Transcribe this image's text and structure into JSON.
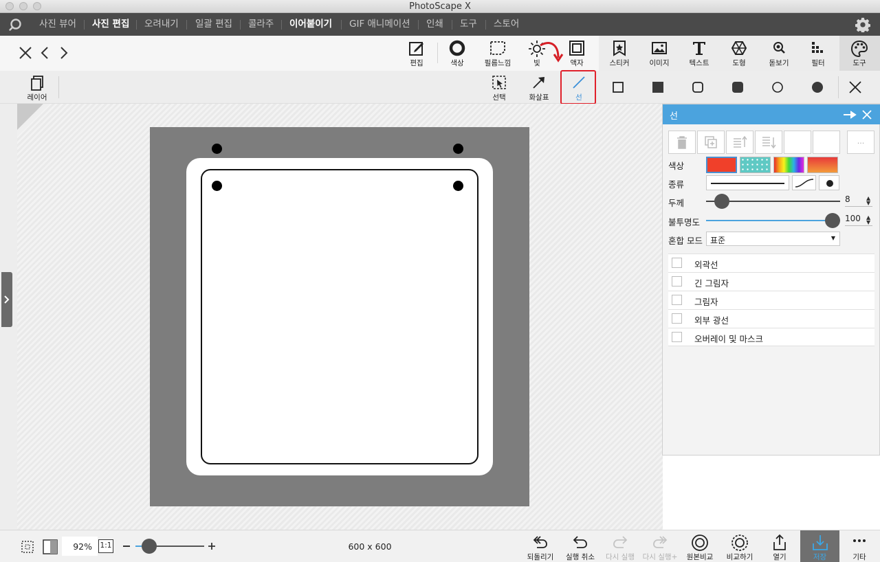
{
  "window": {
    "title": "PhotoScape X"
  },
  "menu": {
    "items": [
      {
        "label": "사진 뷰어"
      },
      {
        "label": "사진 편집"
      },
      {
        "label": "오려내기"
      },
      {
        "label": "일괄 편집"
      },
      {
        "label": "콜라주"
      },
      {
        "label": "이어붙이기"
      },
      {
        "label": "GIF 애니메이션"
      },
      {
        "label": "인쇄"
      },
      {
        "label": "도구"
      },
      {
        "label": "스토어"
      }
    ]
  },
  "toolbar": {
    "tools": [
      {
        "label": "편집",
        "icon": "edit-icon"
      },
      {
        "label": "색상",
        "icon": "color-ring-icon"
      },
      {
        "label": "필름느낌",
        "icon": "film-icon"
      },
      {
        "label": "빛",
        "icon": "sun-icon"
      },
      {
        "label": "액자",
        "icon": "frame-icon"
      },
      {
        "label": "스티커",
        "icon": "sticker-icon"
      },
      {
        "label": "이미지",
        "icon": "image-icon"
      },
      {
        "label": "텍스트",
        "icon": "text-icon"
      },
      {
        "label": "도형",
        "icon": "shape-icon"
      },
      {
        "label": "돋보기",
        "icon": "magnifier-icon"
      },
      {
        "label": "필터",
        "icon": "filter-icon"
      },
      {
        "label": "도구",
        "icon": "palette-icon"
      }
    ]
  },
  "toolbar2": {
    "layer_label": "레이어",
    "select_label": "선택",
    "arrow_label": "화살표",
    "line_label": "선"
  },
  "canvas": {
    "dimensions": "600 x 600"
  },
  "panel": {
    "title": "선",
    "more_label": "...",
    "color_label": "색상",
    "type_label": "종류",
    "thickness_label": "두께",
    "thickness_value": "8",
    "opacity_label": "불투명도",
    "opacity_value": "100",
    "blend_label": "혼합 모드",
    "blend_value": "표준",
    "colors": {
      "solid": "#f0402a",
      "pattern": "#5fc9c4",
      "gradient_end": "#e83a3a"
    },
    "effects": [
      {
        "label": "외곽선",
        "checked": false
      },
      {
        "label": "긴 그림자",
        "checked": false
      },
      {
        "label": "그림자",
        "checked": false
      },
      {
        "label": "외부 광선",
        "checked": false
      },
      {
        "label": "오버레이 및 마스크",
        "checked": false
      }
    ]
  },
  "bottom": {
    "zoom": "92%",
    "zoom_1to1": "1:1",
    "undo_all": "되돌리기",
    "undo": "실행 취소",
    "redo": "다시 실행",
    "redo_all": "다시 실행+",
    "compare_original": "원본비교",
    "compare": "비교하기",
    "open": "열기",
    "save": "저장",
    "more": "기타"
  },
  "accent_colors": {
    "menu_bg": "#4a4a4a",
    "panel_header": "#4ba3de",
    "highlight": "#e0202a",
    "save_icon": "#3aa8e8"
  }
}
